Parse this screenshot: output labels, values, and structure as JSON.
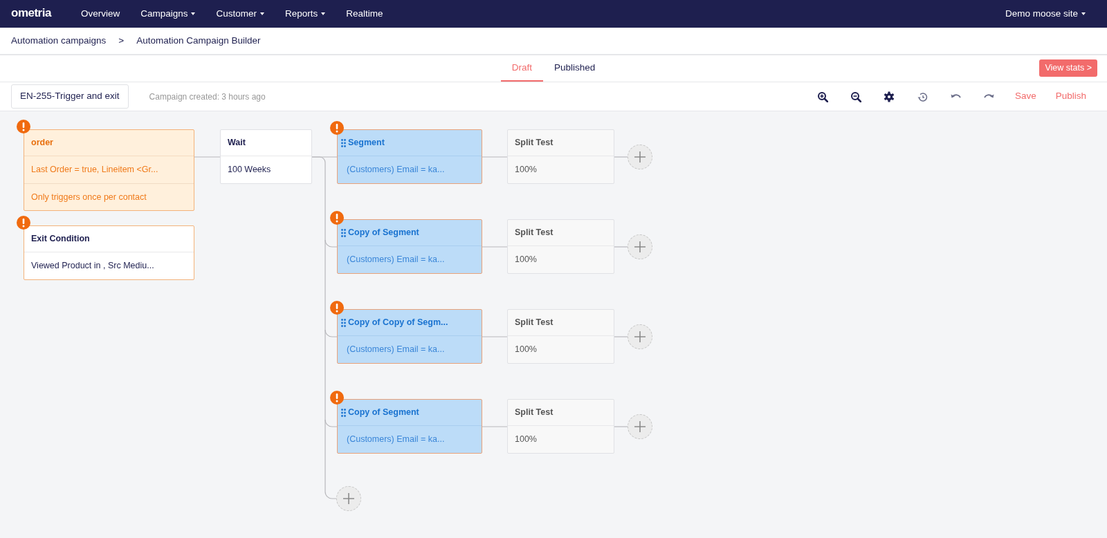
{
  "navbar": {
    "logo": "ometria",
    "items": [
      {
        "label": "Overview",
        "dropdown": false
      },
      {
        "label": "Campaigns",
        "dropdown": true
      },
      {
        "label": "Customer",
        "dropdown": true
      },
      {
        "label": "Reports",
        "dropdown": true
      },
      {
        "label": "Realtime",
        "dropdown": false
      }
    ],
    "site": {
      "label": "Demo moose site",
      "dropdown": true
    }
  },
  "breadcrumb": {
    "items": [
      "Automation campaigns",
      "Automation Campaign Builder"
    ],
    "separator": ">"
  },
  "tabs": [
    {
      "label": "Draft",
      "selected": true
    },
    {
      "label": "Published",
      "selected": false
    }
  ],
  "view_stats": "View stats >",
  "toolbar": {
    "campaign_name": "EN-255-Trigger and exit",
    "created": "Campaign created: 3 hours ago",
    "actions": [
      {
        "kind": "zoom-in"
      },
      {
        "kind": "zoom-out"
      },
      {
        "kind": "settings"
      },
      {
        "kind": "history"
      },
      {
        "kind": "undo"
      },
      {
        "kind": "redo"
      },
      {
        "kind": "text",
        "label": "Save"
      },
      {
        "kind": "text",
        "label": "Publish"
      }
    ]
  },
  "canvas": {
    "trigger": {
      "title": "order",
      "rows": [
        "Last Order = true, Lineitem <Gr...",
        "Only triggers once per contact"
      ],
      "warning": true
    },
    "exit": {
      "title": "Exit Condition",
      "rows": [
        "Viewed Product in , Src Mediu..."
      ],
      "warning": true
    },
    "wait": {
      "title": "Wait",
      "value": "100 Weeks"
    },
    "branches": [
      {
        "segment": {
          "title": "Segment",
          "condition": "(Customers) Email = ka...",
          "warning": true
        },
        "split": {
          "title": "Split Test",
          "value": "100%"
        }
      },
      {
        "segment": {
          "title": "Copy of Segment",
          "condition": "(Customers) Email = ka...",
          "warning": true
        },
        "split": {
          "title": "Split Test",
          "value": "100%"
        }
      },
      {
        "segment": {
          "title": "Copy of Copy of Segm...",
          "condition": "(Customers) Email = ka...",
          "warning": true
        },
        "split": {
          "title": "Split Test",
          "value": "100%"
        }
      },
      {
        "segment": {
          "title": "Copy of Segment",
          "condition": "(Customers) Email = ka...",
          "warning": true
        },
        "split": {
          "title": "Split Test",
          "value": "100%"
        }
      }
    ]
  }
}
